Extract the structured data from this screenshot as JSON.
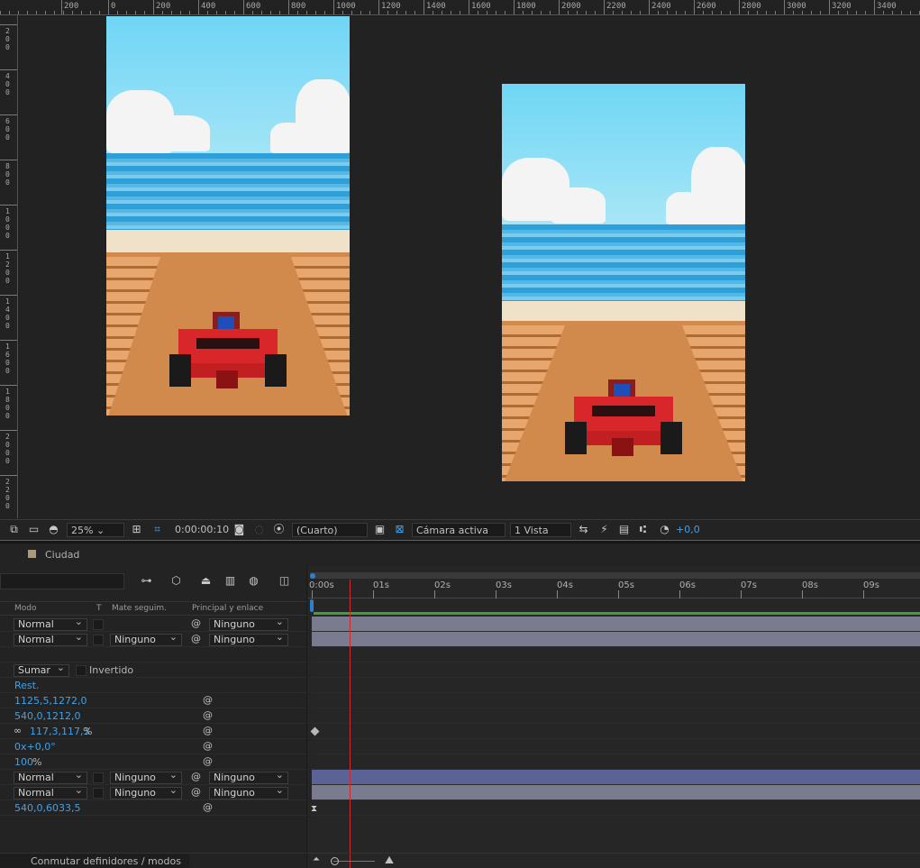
{
  "ruler": {
    "top_labels": [
      "200",
      "0",
      "200",
      "400",
      "600",
      "800",
      "1000",
      "1200",
      "1400",
      "1600",
      "1800",
      "2000",
      "2200",
      "2400",
      "2600",
      "2800",
      "3000",
      "3200",
      "3400"
    ],
    "left_labels": [
      "200",
      "400",
      "600",
      "800",
      "1000",
      "1200",
      "1400",
      "1600",
      "1800",
      "2000",
      "2200"
    ]
  },
  "viewer_toolbar": {
    "zoom": "25%",
    "timecode": "0:00:00:10",
    "resolution": "(Cuarto)",
    "camera": "Cámara activa",
    "views": "1 Vista",
    "exposure": "+0,0"
  },
  "composition": {
    "name": "Ciudad",
    "label_color": "#a89a7a"
  },
  "columns": {
    "mode": "Modo",
    "t": "T",
    "track_matte": "Mate seguim.",
    "parent": "Principal y enlace"
  },
  "layers": [
    {
      "mode": "Normal",
      "matte": "",
      "parent": "Ninguno"
    },
    {
      "mode": "Normal",
      "matte": "Ninguno",
      "parent": "Ninguno"
    }
  ],
  "mask": {
    "mode": "Sumar",
    "inverted_label": "Invertido"
  },
  "transform": {
    "reset": "Rest.",
    "anchor": "1125,5,1272,0",
    "position": "540,0,1212,0",
    "scale": "117,3,117,3",
    "scale_unit": "%",
    "rotation": "0x+0,0°",
    "opacity": "100",
    "opacity_unit": "%"
  },
  "layers_bottom": [
    {
      "mode": "Normal",
      "matte": "Ninguno",
      "parent": "Ninguno"
    },
    {
      "mode": "Normal",
      "matte": "Ninguno",
      "parent": "Ninguno"
    }
  ],
  "position_bottom": "540,0,6033,5",
  "time_ruler": [
    "0:00s",
    "01s",
    "02s",
    "03s",
    "04s",
    "05s",
    "06s",
    "07s",
    "08s",
    "09s"
  ],
  "footer": {
    "toggle_label": "Conmutar definidores / modos"
  },
  "colors": {
    "accent_blue": "#3fa2ea",
    "track_layer": "#7b7b8f",
    "track_selected": "#5b6396",
    "playhead": "#d02b2b",
    "work_area": "#3da13a"
  }
}
